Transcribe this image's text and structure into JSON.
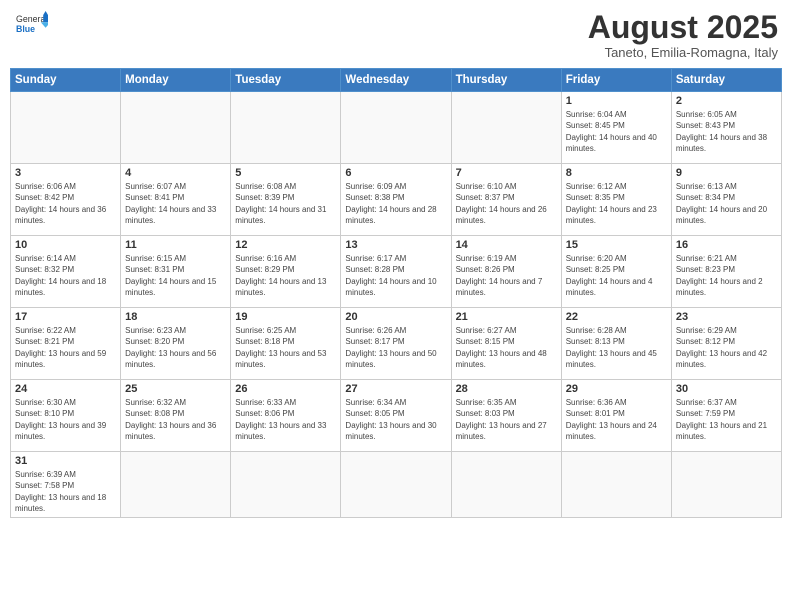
{
  "logo": {
    "text_general": "General",
    "text_blue": "Blue"
  },
  "title": {
    "month_year": "August 2025",
    "location": "Taneto, Emilia-Romagna, Italy"
  },
  "weekdays": [
    "Sunday",
    "Monday",
    "Tuesday",
    "Wednesday",
    "Thursday",
    "Friday",
    "Saturday"
  ],
  "weeks": [
    [
      {
        "day": "",
        "info": ""
      },
      {
        "day": "",
        "info": ""
      },
      {
        "day": "",
        "info": ""
      },
      {
        "day": "",
        "info": ""
      },
      {
        "day": "",
        "info": ""
      },
      {
        "day": "1",
        "info": "Sunrise: 6:04 AM\nSunset: 8:45 PM\nDaylight: 14 hours and 40 minutes."
      },
      {
        "day": "2",
        "info": "Sunrise: 6:05 AM\nSunset: 8:43 PM\nDaylight: 14 hours and 38 minutes."
      }
    ],
    [
      {
        "day": "3",
        "info": "Sunrise: 6:06 AM\nSunset: 8:42 PM\nDaylight: 14 hours and 36 minutes."
      },
      {
        "day": "4",
        "info": "Sunrise: 6:07 AM\nSunset: 8:41 PM\nDaylight: 14 hours and 33 minutes."
      },
      {
        "day": "5",
        "info": "Sunrise: 6:08 AM\nSunset: 8:39 PM\nDaylight: 14 hours and 31 minutes."
      },
      {
        "day": "6",
        "info": "Sunrise: 6:09 AM\nSunset: 8:38 PM\nDaylight: 14 hours and 28 minutes."
      },
      {
        "day": "7",
        "info": "Sunrise: 6:10 AM\nSunset: 8:37 PM\nDaylight: 14 hours and 26 minutes."
      },
      {
        "day": "8",
        "info": "Sunrise: 6:12 AM\nSunset: 8:35 PM\nDaylight: 14 hours and 23 minutes."
      },
      {
        "day": "9",
        "info": "Sunrise: 6:13 AM\nSunset: 8:34 PM\nDaylight: 14 hours and 20 minutes."
      }
    ],
    [
      {
        "day": "10",
        "info": "Sunrise: 6:14 AM\nSunset: 8:32 PM\nDaylight: 14 hours and 18 minutes."
      },
      {
        "day": "11",
        "info": "Sunrise: 6:15 AM\nSunset: 8:31 PM\nDaylight: 14 hours and 15 minutes."
      },
      {
        "day": "12",
        "info": "Sunrise: 6:16 AM\nSunset: 8:29 PM\nDaylight: 14 hours and 13 minutes."
      },
      {
        "day": "13",
        "info": "Sunrise: 6:17 AM\nSunset: 8:28 PM\nDaylight: 14 hours and 10 minutes."
      },
      {
        "day": "14",
        "info": "Sunrise: 6:19 AM\nSunset: 8:26 PM\nDaylight: 14 hours and 7 minutes."
      },
      {
        "day": "15",
        "info": "Sunrise: 6:20 AM\nSunset: 8:25 PM\nDaylight: 14 hours and 4 minutes."
      },
      {
        "day": "16",
        "info": "Sunrise: 6:21 AM\nSunset: 8:23 PM\nDaylight: 14 hours and 2 minutes."
      }
    ],
    [
      {
        "day": "17",
        "info": "Sunrise: 6:22 AM\nSunset: 8:21 PM\nDaylight: 13 hours and 59 minutes."
      },
      {
        "day": "18",
        "info": "Sunrise: 6:23 AM\nSunset: 8:20 PM\nDaylight: 13 hours and 56 minutes."
      },
      {
        "day": "19",
        "info": "Sunrise: 6:25 AM\nSunset: 8:18 PM\nDaylight: 13 hours and 53 minutes."
      },
      {
        "day": "20",
        "info": "Sunrise: 6:26 AM\nSunset: 8:17 PM\nDaylight: 13 hours and 50 minutes."
      },
      {
        "day": "21",
        "info": "Sunrise: 6:27 AM\nSunset: 8:15 PM\nDaylight: 13 hours and 48 minutes."
      },
      {
        "day": "22",
        "info": "Sunrise: 6:28 AM\nSunset: 8:13 PM\nDaylight: 13 hours and 45 minutes."
      },
      {
        "day": "23",
        "info": "Sunrise: 6:29 AM\nSunset: 8:12 PM\nDaylight: 13 hours and 42 minutes."
      }
    ],
    [
      {
        "day": "24",
        "info": "Sunrise: 6:30 AM\nSunset: 8:10 PM\nDaylight: 13 hours and 39 minutes."
      },
      {
        "day": "25",
        "info": "Sunrise: 6:32 AM\nSunset: 8:08 PM\nDaylight: 13 hours and 36 minutes."
      },
      {
        "day": "26",
        "info": "Sunrise: 6:33 AM\nSunset: 8:06 PM\nDaylight: 13 hours and 33 minutes."
      },
      {
        "day": "27",
        "info": "Sunrise: 6:34 AM\nSunset: 8:05 PM\nDaylight: 13 hours and 30 minutes."
      },
      {
        "day": "28",
        "info": "Sunrise: 6:35 AM\nSunset: 8:03 PM\nDaylight: 13 hours and 27 minutes."
      },
      {
        "day": "29",
        "info": "Sunrise: 6:36 AM\nSunset: 8:01 PM\nDaylight: 13 hours and 24 minutes."
      },
      {
        "day": "30",
        "info": "Sunrise: 6:37 AM\nSunset: 7:59 PM\nDaylight: 13 hours and 21 minutes."
      }
    ],
    [
      {
        "day": "31",
        "info": "Sunrise: 6:39 AM\nSunset: 7:58 PM\nDaylight: 13 hours and 18 minutes."
      },
      {
        "day": "",
        "info": ""
      },
      {
        "day": "",
        "info": ""
      },
      {
        "day": "",
        "info": ""
      },
      {
        "day": "",
        "info": ""
      },
      {
        "day": "",
        "info": ""
      },
      {
        "day": "",
        "info": ""
      }
    ]
  ]
}
